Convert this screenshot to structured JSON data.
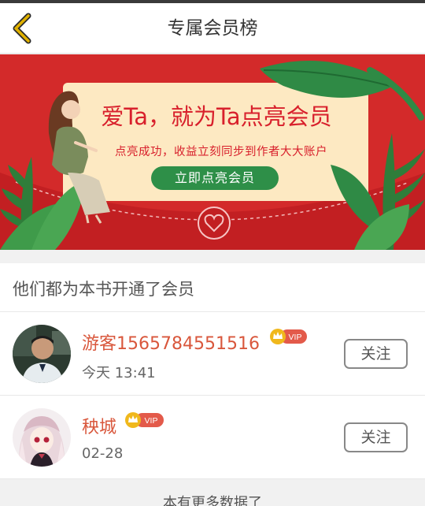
{
  "header": {
    "title": "专属会员榜",
    "back_icon": "chevron-left-icon",
    "accent_color": "#e0b100"
  },
  "banner": {
    "headline": "爱Ta，就为Ta点亮会员",
    "subtitle": "点亮成功，收益立刻同步到作者大大账户",
    "button_label": "立即点亮会员",
    "background_color": "#d32a2a",
    "card_color": "#fde9c2",
    "button_color": "#2e8f48"
  },
  "members_section": {
    "title": "他们都为本书开通了会员"
  },
  "members": [
    {
      "name": "游客1565784551516",
      "badge": "VIP",
      "time": "今天 13:41",
      "follow_label": "关注"
    },
    {
      "name": "秧城",
      "badge": "VIP",
      "time": "02-28",
      "follow_label": "关注"
    }
  ],
  "footer": {
    "text": "本有更多数据了"
  }
}
